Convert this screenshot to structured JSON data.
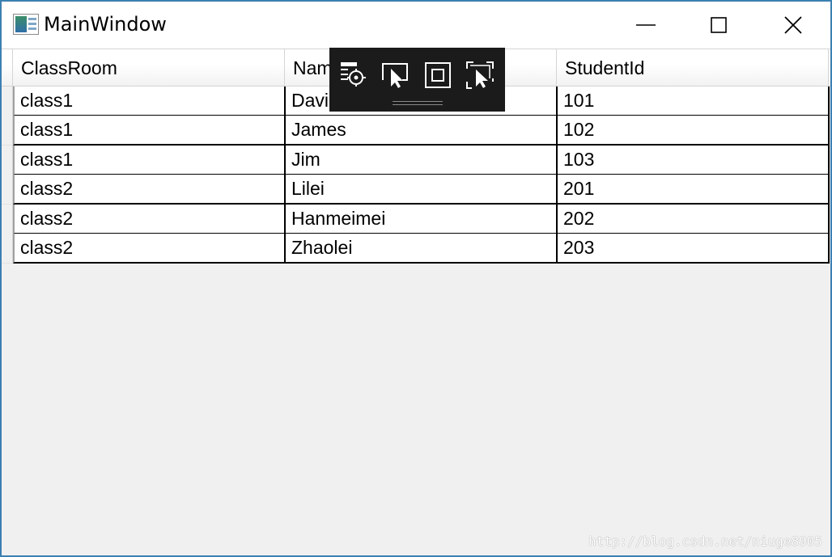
{
  "window": {
    "title": "MainWindow",
    "border_color": "#3c7fb1"
  },
  "grid": {
    "columns": [
      "ClassRoom",
      "Name",
      "StudentId"
    ],
    "rows": [
      [
        "class1",
        "David",
        "101"
      ],
      [
        "class1",
        "James",
        "102"
      ],
      [
        "class1",
        "Jim",
        "103"
      ],
      [
        "class2",
        "Lilei",
        "201"
      ],
      [
        "class2",
        "Hanmeimei",
        "202"
      ],
      [
        "class2",
        "Zhaolei",
        "203"
      ]
    ]
  },
  "debug_toolbar": {
    "tools": [
      "go-to-live-visual-tree-icon",
      "select-element-icon",
      "display-layout-adorners-icon",
      "track-focused-element-icon"
    ]
  },
  "watermark": {
    "text": "http://blog.csdn.net/niuge8905"
  }
}
